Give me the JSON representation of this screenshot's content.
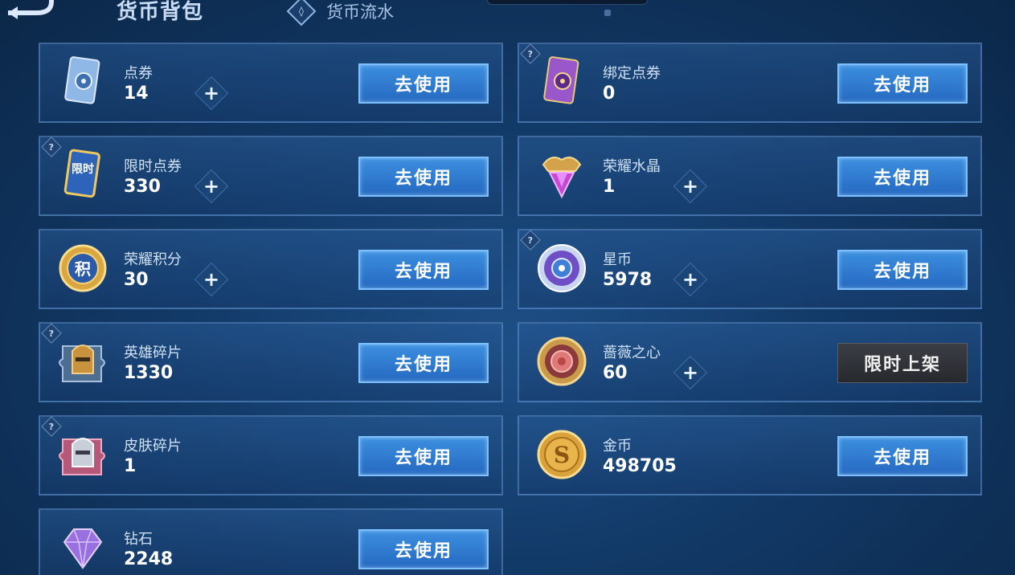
{
  "header": {
    "title": "货币背包",
    "flow_label": "货币流水"
  },
  "colors": {
    "accent": "#2f7dd6",
    "card_border": "#6ea0dc",
    "disabled_button": "#2f3237"
  },
  "items": [
    {
      "name": "点券",
      "amount": "14",
      "button": "去使用",
      "icon": "ticket-card-icon",
      "help": false,
      "plus": true
    },
    {
      "name": "绑定点券",
      "amount": "0",
      "button": "去使用",
      "icon": "bound-ticket-card-icon",
      "help": true,
      "plus": false
    },
    {
      "name": "限时点券",
      "amount": "330",
      "button": "去使用",
      "icon": "limited-ticket-icon",
      "help": true,
      "plus": true,
      "icon_text": "限时"
    },
    {
      "name": "荣耀水晶",
      "amount": "1",
      "button": "去使用",
      "icon": "glory-crystal-icon",
      "help": false,
      "plus": true
    },
    {
      "name": "荣耀积分",
      "amount": "30",
      "button": "去使用",
      "icon": "glory-points-coin-icon",
      "help": false,
      "plus": true,
      "icon_text": "积"
    },
    {
      "name": "星币",
      "amount": "5978",
      "button": "去使用",
      "icon": "star-coin-icon",
      "help": true,
      "plus": true
    },
    {
      "name": "英雄碎片",
      "amount": "1330",
      "button": "去使用",
      "icon": "hero-fragment-icon",
      "help": true,
      "plus": false
    },
    {
      "name": "蔷薇之心",
      "amount": "60",
      "button": "限时上架",
      "icon": "rose-heart-coin-icon",
      "help": false,
      "plus": true,
      "disabled": true
    },
    {
      "name": "皮肤碎片",
      "amount": "1",
      "button": "去使用",
      "icon": "skin-fragment-icon",
      "help": true,
      "plus": false
    },
    {
      "name": "金币",
      "amount": "498705",
      "button": "去使用",
      "icon": "gold-coin-icon",
      "help": false,
      "plus": false,
      "icon_text": "S"
    },
    {
      "name": "钻石",
      "amount": "2248",
      "button": "去使用",
      "icon": "diamond-icon",
      "help": false,
      "plus": false
    }
  ],
  "help_symbol": "?",
  "plus_symbol": "+"
}
